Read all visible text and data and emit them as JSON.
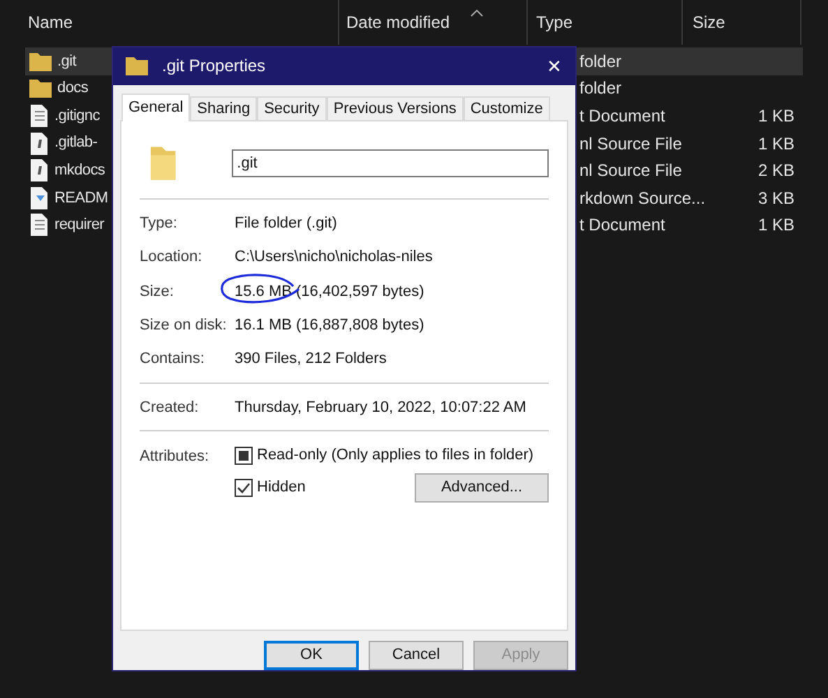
{
  "explorer": {
    "columns": [
      {
        "label": "Name",
        "sorted": false
      },
      {
        "label": "Date modified",
        "sorted": true
      },
      {
        "label": "Type",
        "sorted": false
      },
      {
        "label": "Size",
        "sorted": false
      }
    ],
    "rows": [
      {
        "name": ".git",
        "kind": "folder",
        "type": "folder",
        "selected": true
      },
      {
        "name": "docs",
        "kind": "folder",
        "type": "folder",
        "selected": false
      },
      {
        "name": ".gitignc",
        "kind": "text",
        "type": "t Document",
        "size": "1 KB",
        "selected": false
      },
      {
        "name": ".gitlab-",
        "kind": "script",
        "type": "nl Source File",
        "size": "1 KB",
        "selected": false
      },
      {
        "name": "mkdocs",
        "kind": "script",
        "type": "nl Source File",
        "size": "2 KB",
        "selected": false
      },
      {
        "name": "READM",
        "kind": "markdown",
        "type": "rkdown Source...",
        "size": "3 KB",
        "selected": false
      },
      {
        "name": "requirer",
        "kind": "text",
        "type": "t Document",
        "size": "1 KB",
        "selected": false
      }
    ]
  },
  "dialog": {
    "title": ".git Properties",
    "close": "✕",
    "tabs": [
      {
        "label": "General",
        "selected": true
      },
      {
        "label": "Sharing",
        "selected": false
      },
      {
        "label": "Security",
        "selected": false
      },
      {
        "label": "Previous Versions",
        "selected": false
      },
      {
        "label": "Customize",
        "selected": false
      }
    ],
    "name_field": {
      "value": ".git"
    },
    "groups": [
      [
        {
          "label": "Type:",
          "value": "File folder (.git)"
        },
        {
          "label": "Location:",
          "value": "C:\\Users\\nicho\\nicholas-niles"
        },
        {
          "label": "Size:",
          "value": "15.6 MB (16,402,597 bytes)",
          "circled": true
        },
        {
          "label": "Size on disk:",
          "value": "16.1 MB (16,887,808 bytes)"
        },
        {
          "label": "Contains:",
          "value": "390 Files, 212 Folders"
        }
      ],
      [
        {
          "label": "Created:",
          "value": "Thursday, February 10, 2022, 10:07:22 AM"
        }
      ]
    ],
    "attributes": {
      "label": "Attributes:",
      "checkboxes": [
        {
          "label": "Read-only (Only applies to files in folder)",
          "checked": true,
          "partial": true
        },
        {
          "label": "Hidden",
          "checked": true,
          "partial": false
        }
      ],
      "advanced": "Advanced..."
    },
    "buttons": [
      {
        "label": "OK",
        "default": true,
        "disabled": false
      },
      {
        "label": "Cancel",
        "default": false,
        "disabled": false
      },
      {
        "label": "Apply",
        "default": false,
        "disabled": true
      }
    ]
  }
}
